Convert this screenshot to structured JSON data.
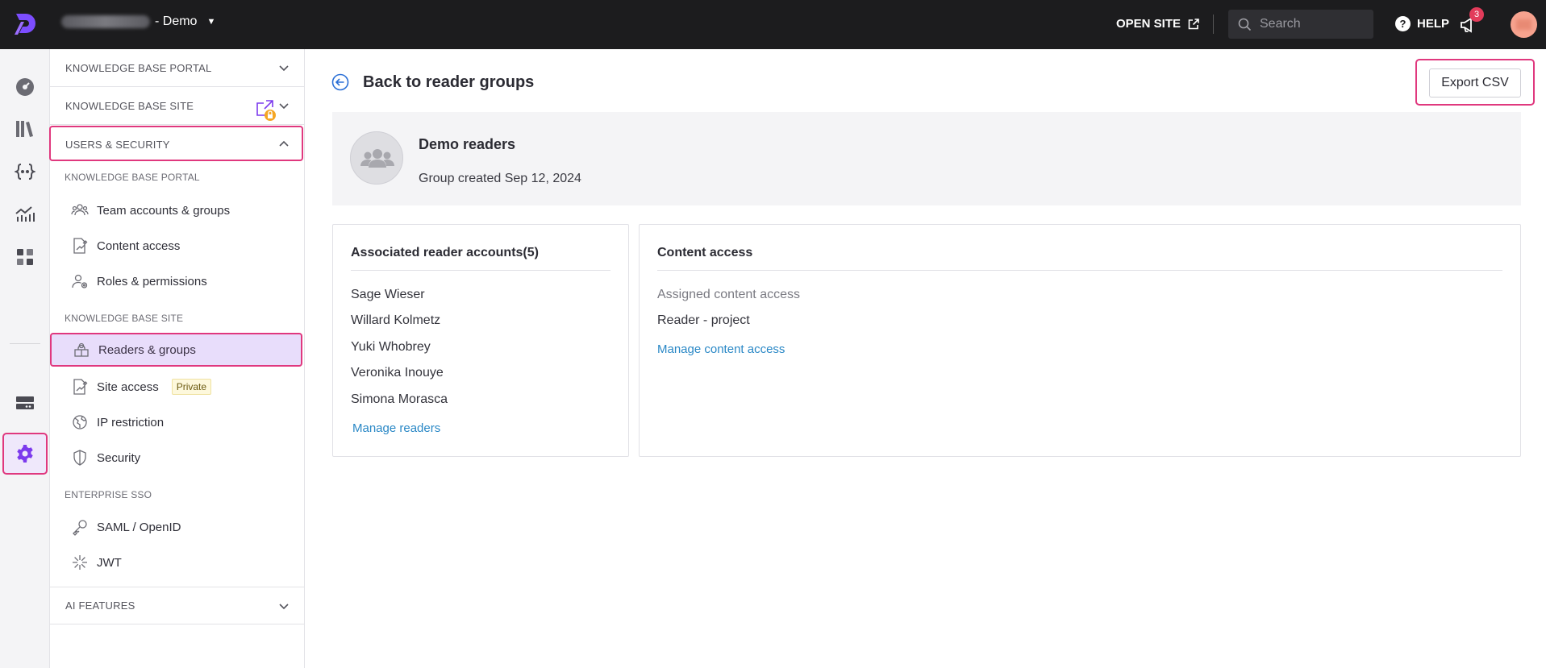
{
  "topbar": {
    "project_suffix": "- Demo",
    "open_site": "OPEN SITE",
    "search_placeholder": "Search",
    "help": "HELP",
    "notification_count": "3"
  },
  "nav": {
    "sections": {
      "kb_portal": "KNOWLEDGE BASE PORTAL",
      "kb_site": "KNOWLEDGE BASE SITE",
      "users_security": "USERS & SECURITY",
      "ai_features": "AI FEATURES"
    },
    "sub_kb_portal": "KNOWLEDGE BASE PORTAL",
    "items_portal": [
      {
        "label": "Team accounts & groups",
        "icon": "team-icon"
      },
      {
        "label": "Content access",
        "icon": "content-access-icon"
      },
      {
        "label": "Roles & permissions",
        "icon": "roles-icon"
      }
    ],
    "sub_kb_site": "KNOWLEDGE BASE SITE",
    "items_site": [
      {
        "label": "Readers & groups",
        "icon": "readers-icon",
        "active": true
      },
      {
        "label": "Site access",
        "icon": "site-access-icon",
        "tag": "Private"
      },
      {
        "label": "IP restriction",
        "icon": "ip-icon"
      },
      {
        "label": "Security",
        "icon": "shield-icon"
      }
    ],
    "sub_sso": "ENTERPRISE SSO",
    "items_sso": [
      {
        "label": "SAML / OpenID",
        "icon": "key-icon"
      },
      {
        "label": "JWT",
        "icon": "jwt-icon"
      }
    ]
  },
  "main": {
    "back_title": "Back to reader groups",
    "export_label": "Export CSV",
    "group": {
      "name": "Demo readers",
      "created": "Group created Sep 12, 2024"
    },
    "readers_panel": {
      "title": "Associated reader accounts(5)",
      "readers": [
        "Sage Wieser",
        "Willard Kolmetz",
        "Yuki Whobrey",
        "Veronika Inouye",
        "Simona Morasca"
      ],
      "manage_link": "Manage readers"
    },
    "access_panel": {
      "title": "Content access",
      "assigned_label": "Assigned content access",
      "value": "Reader - project",
      "manage_link": "Manage content access"
    }
  },
  "colors": {
    "accent": "#7c3aed",
    "highlight_border": "#e0387e",
    "link": "#2a88c6",
    "topbar_bg": "#1c1c1e"
  }
}
